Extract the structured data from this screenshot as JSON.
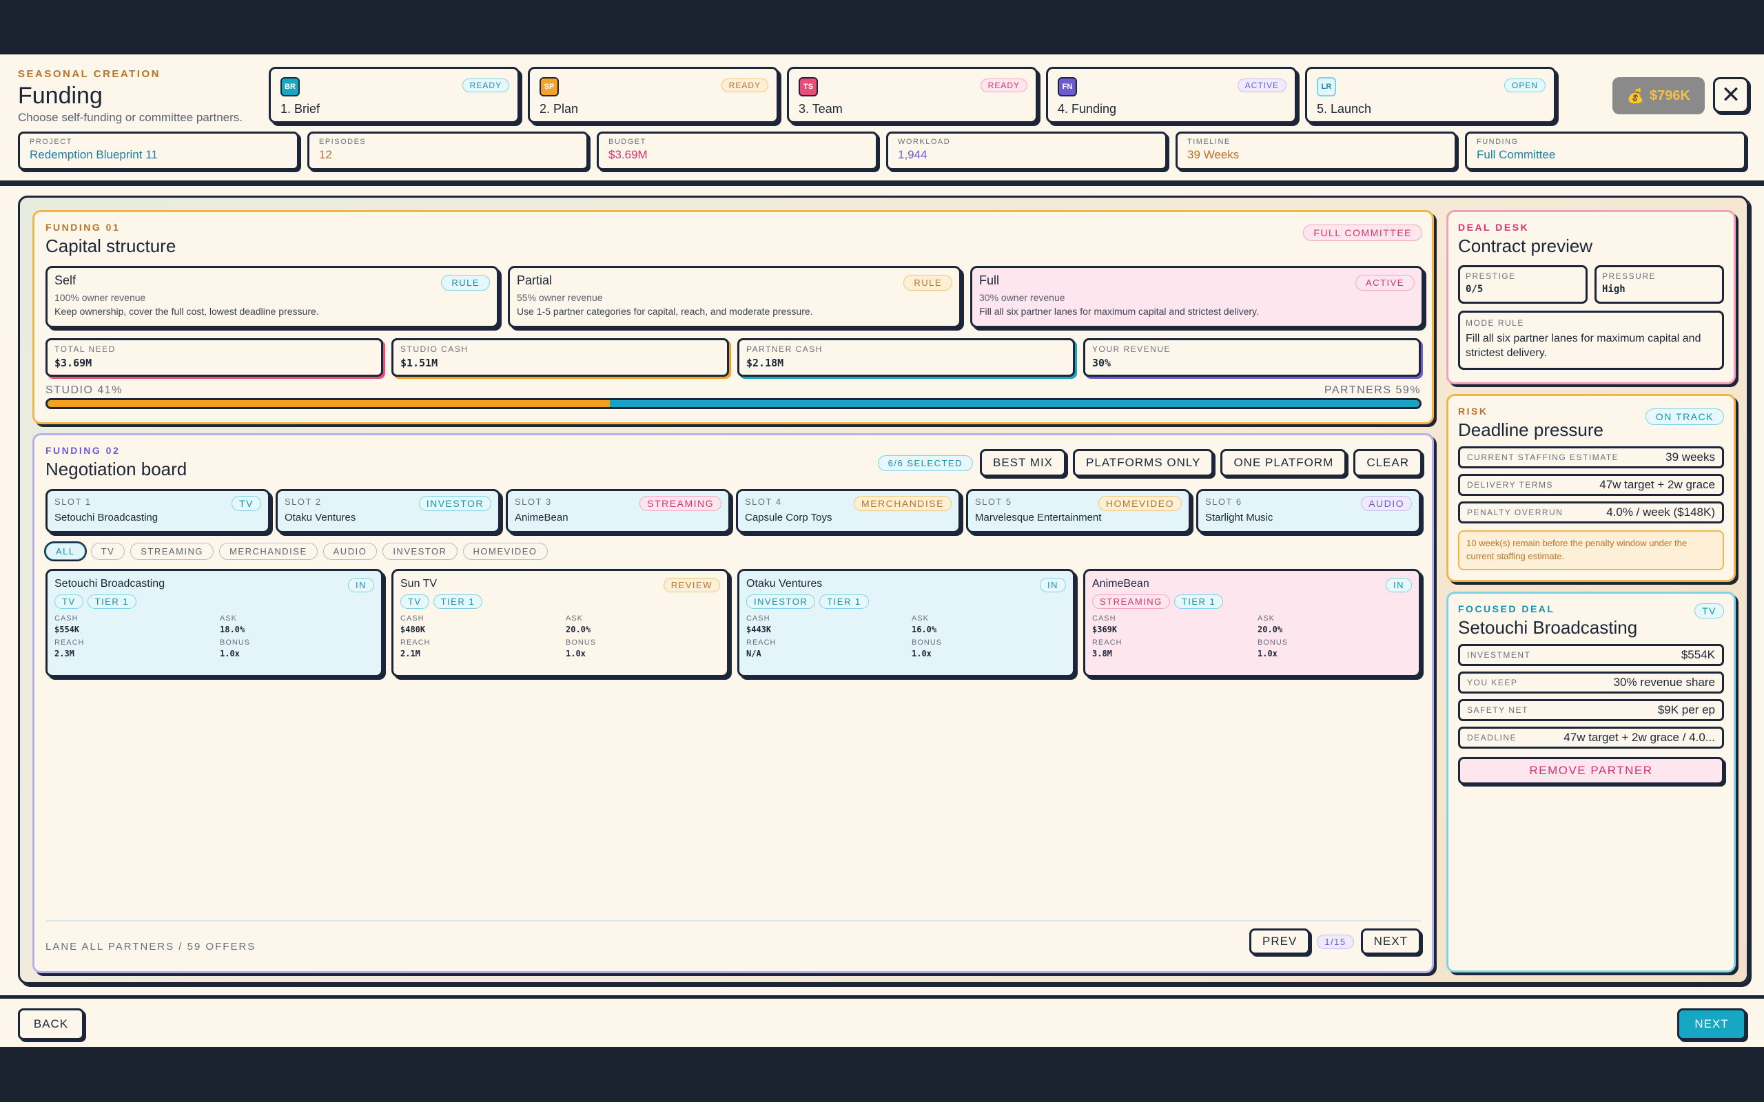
{
  "header": {
    "eyebrow": "SEASONAL CREATION",
    "title": "Funding",
    "subtitle": "Choose self-funding or committee partners."
  },
  "steps": [
    {
      "badge": "BR",
      "label": "1. Brief",
      "status": "READY",
      "color": "#16a7c4",
      "tone": "teal"
    },
    {
      "badge": "SP",
      "label": "2. Plan",
      "status": "READY",
      "color": "#f3a426",
      "tone": "orange"
    },
    {
      "badge": "TS",
      "label": "3. Team",
      "status": "READY",
      "color": "#ef4b79",
      "tone": "pink"
    },
    {
      "badge": "FN",
      "label": "4. Funding",
      "status": "ACTIVE",
      "color": "#6d5bd0",
      "tone": "purple"
    },
    {
      "badge": "LR",
      "label": "5. Launch",
      "status": "OPEN",
      "color": "#e3f5f8",
      "tone": "teal"
    }
  ],
  "cash": {
    "icon": "money-bag-icon",
    "value": "$796K"
  },
  "close_icon": "close-icon",
  "fields": [
    {
      "key": "PROJECT",
      "value": "Redemption Blueprint 11",
      "color": "#1d7fa0"
    },
    {
      "key": "EPISODES",
      "value": "12",
      "color": "#b9742a"
    },
    {
      "key": "BUDGET",
      "value": "$3.69M",
      "color": "#d7336e"
    },
    {
      "key": "WORKLOAD",
      "value": "1,944",
      "color": "#6d5bd0"
    },
    {
      "key": "TIMELINE",
      "value": "39 Weeks",
      "color": "#b9742a"
    },
    {
      "key": "FUNDING",
      "value": "Full Committee",
      "color": "#1d7fa0"
    }
  ],
  "capital": {
    "eyebrow": "FUNDING 01",
    "title": "Capital structure",
    "badge": "FULL COMMITTEE",
    "modes": [
      {
        "name": "Self",
        "tag": "RULE",
        "share": "100% owner revenue",
        "desc": "Keep ownership, cover the full cost, lowest deadline pressure."
      },
      {
        "name": "Partial",
        "tag": "RULE",
        "share": "55% owner revenue",
        "desc": "Use 1-5 partner categories for capital, reach, and moderate pressure."
      },
      {
        "name": "Full",
        "tag": "ACTIVE",
        "share": "30% owner revenue",
        "desc": "Fill all six partner lanes for maximum capital and strictest delivery."
      }
    ],
    "stats": [
      {
        "key": "TOTAL NEED",
        "value": "$3.69M"
      },
      {
        "key": "STUDIO CASH",
        "value": "$1.51M"
      },
      {
        "key": "PARTNER CASH",
        "value": "$2.18M"
      },
      {
        "key": "YOUR REVENUE",
        "value": "30%"
      }
    ],
    "studio_label": "STUDIO 41%",
    "partners_label": "PARTNERS 59%",
    "studio_share": 0.41
  },
  "negotiation": {
    "eyebrow": "FUNDING 02",
    "title": "Negotiation board",
    "selected": "6/6 SELECTED",
    "actions": [
      "BEST MIX",
      "PLATFORMS ONLY",
      "ONE PLATFORM",
      "CLEAR"
    ],
    "slots": [
      {
        "key": "SLOT 1",
        "tag": "TV",
        "name": "Setouchi Broadcasting",
        "tone": "teal"
      },
      {
        "key": "SLOT 2",
        "tag": "INVESTOR",
        "name": "Otaku Ventures",
        "tone": "teal"
      },
      {
        "key": "SLOT 3",
        "tag": "STREAMING",
        "name": "AnimeBean",
        "tone": "pink"
      },
      {
        "key": "SLOT 4",
        "tag": "MERCHANDISE",
        "name": "Capsule Corp Toys",
        "tone": "orange"
      },
      {
        "key": "SLOT 5",
        "tag": "HOMEVIDEO",
        "name": "Marvelesque Entertainment",
        "tone": "orange"
      },
      {
        "key": "SLOT 6",
        "tag": "AUDIO",
        "name": "Starlight Music",
        "tone": "purple"
      }
    ],
    "filters": [
      "ALL",
      "TV",
      "STREAMING",
      "MERCHANDISE",
      "AUDIO",
      "INVESTOR",
      "HOMEVIDEO"
    ],
    "offers": [
      {
        "name": "Setouchi Broadcasting",
        "status": "IN",
        "tags": [
          "TV",
          "TIER 1"
        ],
        "cash": "$554K",
        "ask": "18.0%",
        "reach": "2.3M",
        "bonus": "1.0x",
        "bg": "#e3f5f8"
      },
      {
        "name": "Sun TV",
        "status": "REVIEW",
        "tags": [
          "TV",
          "TIER 1"
        ],
        "cash": "$480K",
        "ask": "20.0%",
        "reach": "2.1M",
        "bonus": "1.0x",
        "bg": "#fdf6ea"
      },
      {
        "name": "Otaku Ventures",
        "status": "IN",
        "tags": [
          "INVESTOR",
          "TIER 1"
        ],
        "cash": "$443K",
        "ask": "16.0%",
        "reach": "N/A",
        "bonus": "1.0x",
        "bg": "#e3f5f8"
      },
      {
        "name": "AnimeBean",
        "status": "IN",
        "tags": [
          "STREAMING",
          "TIER 1"
        ],
        "cash": "$369K",
        "ask": "20.0%",
        "reach": "3.8M",
        "bonus": "1.0x",
        "bg": "#fde6ee"
      }
    ],
    "labels": {
      "cash": "CASH",
      "ask": "ASK",
      "reach": "REACH",
      "bonus": "BONUS"
    },
    "footer": "LANE ALL PARTNERS / 59 OFFERS",
    "prev": "PREV",
    "page": "1/15",
    "next": "NEXT"
  },
  "deal": {
    "eyebrow": "DEAL DESK",
    "title": "Contract preview",
    "prestige_k": "PRESTIGE",
    "prestige_v": "0/5",
    "pressure_k": "PRESSURE",
    "pressure_v": "High",
    "rule_k": "MODE RULE",
    "rule_v": "Fill all six partner lanes for maximum capital and strictest delivery."
  },
  "risk": {
    "eyebrow": "RISK",
    "title": "Deadline pressure",
    "badge": "ON TRACK",
    "rows": [
      {
        "key": "CURRENT STAFFING ESTIMATE",
        "value": "39 weeks"
      },
      {
        "key": "DELIVERY TERMS",
        "value": "47w target + 2w grace"
      },
      {
        "key": "PENALTY OVERRUN",
        "value": "4.0% / week ($148K)"
      }
    ],
    "note": "10 week(s) remain before the penalty window under the current staffing estimate."
  },
  "focus": {
    "eyebrow": "FOCUSED DEAL",
    "title": "Setouchi Broadcasting",
    "badge": "TV",
    "rows": [
      {
        "key": "INVESTMENT",
        "value": "$554K"
      },
      {
        "key": "YOU KEEP",
        "value": "30% revenue share"
      },
      {
        "key": "SAFETY NET",
        "value": "$9K per ep"
      },
      {
        "key": "DEADLINE",
        "value": "47w target + 2w grace / 4.0..."
      }
    ],
    "remove": "REMOVE PARTNER"
  },
  "footer": {
    "back": "BACK",
    "next": "NEXT"
  }
}
